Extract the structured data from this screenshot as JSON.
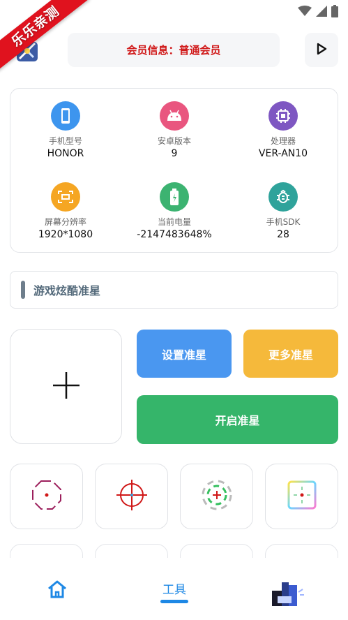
{
  "branding": {
    "ribbon_text": "乐乐亲测"
  },
  "header": {
    "member_info": "会员信息：普通会员"
  },
  "device_info": [
    {
      "label": "手机型号",
      "value": "HONOR",
      "icon": "phone-icon",
      "color": "#3d95ee"
    },
    {
      "label": "安卓版本",
      "value": "9",
      "icon": "android-icon",
      "color": "#e9567f"
    },
    {
      "label": "处理器",
      "value": "VER-AN10",
      "icon": "cpu-icon",
      "color": "#7e57c2"
    },
    {
      "label": "屏幕分辨率",
      "value": "1920*1080",
      "icon": "screen-icon",
      "color": "#f5a623"
    },
    {
      "label": "当前电量",
      "value": "-2147483648%",
      "icon": "battery-icon",
      "color": "#3cb371"
    },
    {
      "label": "手机SDK",
      "value": "28",
      "icon": "sdk-icon",
      "color": "#2fa39b"
    }
  ],
  "section": {
    "title": "游戏炫酷准星"
  },
  "buttons": {
    "set_crosshair": "设置准星",
    "more_crosshair": "更多准星",
    "open_crosshair": "开启准星"
  },
  "nav": {
    "tools_label": "工具"
  },
  "colors": {
    "accent": "#1e88e5",
    "member_text": "#d01818",
    "blue_button": "#4a97f0",
    "yellow_button": "#f5b93b",
    "green_button": "#35b56a"
  }
}
